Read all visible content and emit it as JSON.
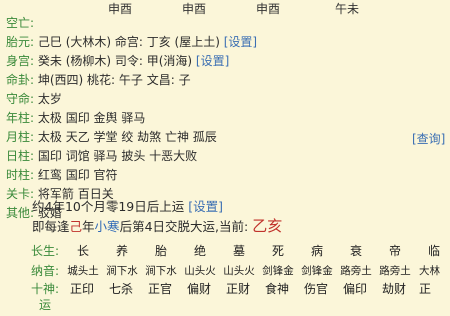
{
  "top_header": [
    "申酉",
    "申酉",
    "申酉",
    "午未"
  ],
  "info_rows": [
    {
      "label": "空亡:",
      "value": "",
      "extra": ""
    },
    {
      "label": "胎元:",
      "value": "己巳 (大林木)  命宫: 丁亥 (屋上土)",
      "extra": "[设置]"
    },
    {
      "label": "身宫:",
      "value": "癸未 (杨柳木)  司令: 甲(消海)",
      "extra": "[设置]"
    },
    {
      "label": "命卦:",
      "value": "坤(西四) 桃花: 午子 文昌: 子",
      "extra": ""
    },
    {
      "label": "守命:",
      "value": "太岁",
      "extra": ""
    },
    {
      "label": "年柱:",
      "value": "太极 国印 金舆 驿马",
      "extra": ""
    },
    {
      "label": "月柱:",
      "value": "太极 天乙 学堂 绞 劫煞 亡神 孤辰",
      "extra": ""
    },
    {
      "label": "日柱:",
      "value": "国印 词馆 驿马 披头 十恶大败",
      "extra": ""
    },
    {
      "label": "时柱:",
      "value": "红鸾 国印 官符",
      "extra": ""
    },
    {
      "label": "关卡:",
      "value": "将军箭 百日关",
      "extra": ""
    },
    {
      "label": "其他:",
      "value": "驳婚",
      "extra": ""
    }
  ],
  "query_link": "[查询]",
  "dayun_line1": "约4年10个月零19日后上运",
  "dayun_line1_link": "[设置]",
  "dayun_line2_prefix": "即每逢",
  "dayun_line2_gan": "己",
  "dayun_line2_mid1": "年",
  "dayun_line2_term": "小寒",
  "dayun_line2_mid2": "后第4日交脱大运,当前:",
  "dayun_current": "乙亥",
  "table": {
    "changsheng_label": "长生:",
    "changsheng": [
      "长",
      "养",
      "胎",
      "绝",
      "墓",
      "死",
      "病",
      "衰",
      "帝",
      "临"
    ],
    "nayin_label": "纳音:",
    "nayin": [
      "城头土",
      "涧下水",
      "涧下水",
      "山头火",
      "山头火",
      "剑锋金",
      "剑锋金",
      "路旁土",
      "路旁土",
      "大林"
    ],
    "shishen_label": "十神:",
    "shishen": [
      "正印",
      "七杀",
      "正官",
      "偏财",
      "正财",
      "食神",
      "伤官",
      "偏印",
      "劫财",
      "正"
    ],
    "bottom_label": "运",
    "bottom": [
      "",
      "",
      "",
      "",
      "",
      "",
      "",
      "",
      "",
      ""
    ]
  },
  "colors": {
    "background": "#fbf6d9",
    "label_green": "#3a8a3a",
    "link_blue": "#3b6fb3",
    "accent_red": "#c0312b",
    "accent_blue": "#2f69b7"
  }
}
